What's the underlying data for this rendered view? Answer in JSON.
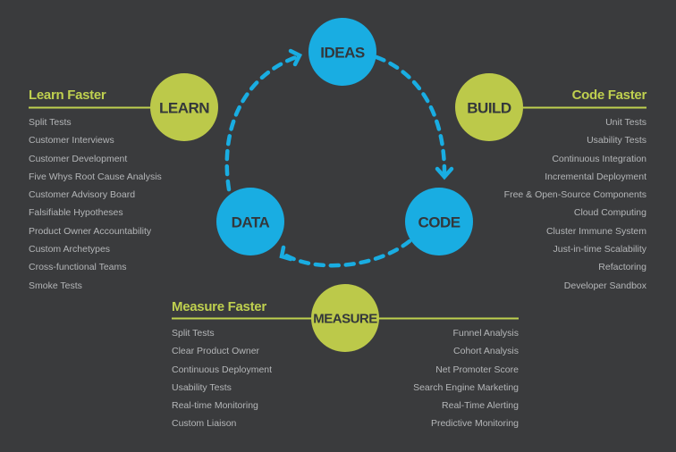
{
  "colors": {
    "background": "#3a3b3d",
    "blue": "#19ade2",
    "green": "#bcc94a",
    "heading": "#bfd04f",
    "item_text": "#b4b6b8",
    "circle_text": "#33373b"
  },
  "cycle_nodes": [
    {
      "id": "ideas",
      "label": "IDEAS"
    },
    {
      "id": "code",
      "label": "CODE"
    },
    {
      "id": "data",
      "label": "DATA"
    }
  ],
  "stage_nodes": [
    {
      "id": "learn",
      "label": "LEARN"
    },
    {
      "id": "build",
      "label": "BUILD"
    },
    {
      "id": "measure",
      "label": "MEASURE"
    }
  ],
  "arrows": [
    {
      "from": "IDEAS",
      "to": "CODE"
    },
    {
      "from": "CODE",
      "to": "DATA"
    },
    {
      "from": "DATA",
      "to": "IDEAS"
    }
  ],
  "learn": {
    "heading": "Learn Faster",
    "items": [
      "Split Tests",
      "Customer Interviews",
      "Customer Development",
      "Five Whys Root Cause Analysis",
      "Customer Advisory Board",
      "Falsifiable Hypotheses",
      "Product Owner Accountability",
      "Custom Archetypes",
      "Cross-functional Teams",
      "Smoke Tests"
    ]
  },
  "build": {
    "heading": "Code Faster",
    "items": [
      "Unit Tests",
      "Usability Tests",
      "Continuous Integration",
      "Incremental Deployment",
      "Free & Open-Source Components",
      "Cloud Computing",
      "Cluster Immune System",
      "Just-in-time Scalability",
      "Refactoring",
      "Developer Sandbox"
    ]
  },
  "measure": {
    "heading": "Measure Faster",
    "items_left": [
      "Split Tests",
      "Clear Product Owner",
      "Continuous Deployment",
      "Usability Tests",
      "Real-time Monitoring",
      "Custom Liaison"
    ],
    "items_right": [
      "Funnel Analysis",
      "Cohort Analysis",
      "Net Promoter Score",
      "Search Engine Marketing",
      "Real-Time Alerting",
      "Predictive Monitoring"
    ]
  }
}
